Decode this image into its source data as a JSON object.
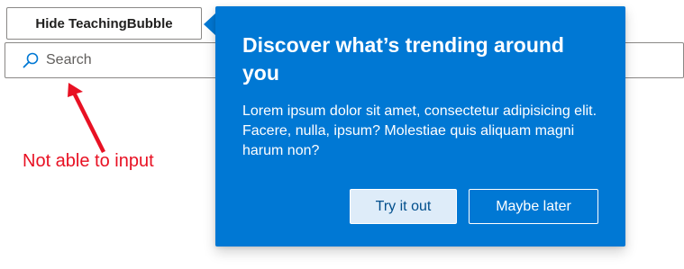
{
  "toggle_button": {
    "label": "Hide TeachingBubble"
  },
  "search": {
    "placeholder": "Search",
    "value": ""
  },
  "annotation": {
    "text": "Not able to input",
    "color": "#e81123"
  },
  "teaching_bubble": {
    "title": "Discover what’s trending around you",
    "body": "Lorem ipsum dolor sit amet, consectetur adipisicing elit. Facere, nulla, ipsum? Molestiae quis aliquam magni harum non?",
    "primary_button": "Try it out",
    "secondary_button": "Maybe later",
    "background_color": "#0078d4"
  },
  "icons": {
    "search": "search-icon",
    "arrow": "annotation-arrow-icon"
  }
}
